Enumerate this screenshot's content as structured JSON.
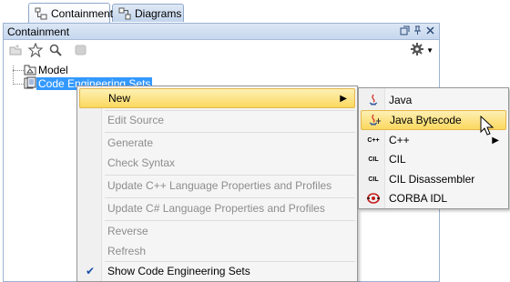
{
  "tabs": [
    {
      "label": "Containment",
      "icon": "containment-icon",
      "active": true
    },
    {
      "label": "Diagrams",
      "icon": "diagrams-icon",
      "active": false
    }
  ],
  "panel": {
    "title": "Containment",
    "toolbar_icons": [
      "new-element-icon",
      "favorite-star-icon",
      "search-icon",
      "collapse-icon",
      "settings-gear-icon"
    ]
  },
  "tree": {
    "items": [
      {
        "label": "Model",
        "icon": "model-package-icon",
        "selected": false
      },
      {
        "label": "Code Engineering Sets",
        "icon": "code-engineering-icon",
        "selected": true
      }
    ]
  },
  "context_menu": {
    "items": [
      {
        "label": "New",
        "enabled": true,
        "has_submenu": true,
        "highlighted": true
      },
      {
        "label": "Edit Source",
        "enabled": false
      },
      {
        "label": "Generate",
        "enabled": false
      },
      {
        "label": "Check Syntax",
        "enabled": false
      },
      {
        "label": "Update C++ Language Properties and Profiles",
        "enabled": false
      },
      {
        "label": "Update C# Language Properties and Profiles",
        "enabled": false
      },
      {
        "label": "Reverse",
        "enabled": false
      },
      {
        "label": "Refresh",
        "enabled": false
      },
      {
        "label": "Show Code Engineering Sets",
        "enabled": true,
        "checked": true
      }
    ]
  },
  "submenu": {
    "items": [
      {
        "label": "Java",
        "icon": "java-icon"
      },
      {
        "label": "Java Bytecode",
        "icon": "java-bytecode-icon",
        "highlighted": true
      },
      {
        "label": "C++",
        "icon": "cpp-icon",
        "icon_text": "C++",
        "has_submenu": true
      },
      {
        "label": "CIL",
        "icon": "cil-icon",
        "icon_text": "CIL"
      },
      {
        "label": "CIL Disassembler",
        "icon": "cil-disassembler-icon",
        "icon_text": "CIL"
      },
      {
        "label": "CORBA IDL",
        "icon": "corba-idl-icon"
      }
    ]
  },
  "colors": {
    "selection": "#3399ff",
    "menu_highlight": "#fbd85f",
    "panel_header": "#c6d7ee",
    "disabled_text": "#8d8d8d"
  }
}
